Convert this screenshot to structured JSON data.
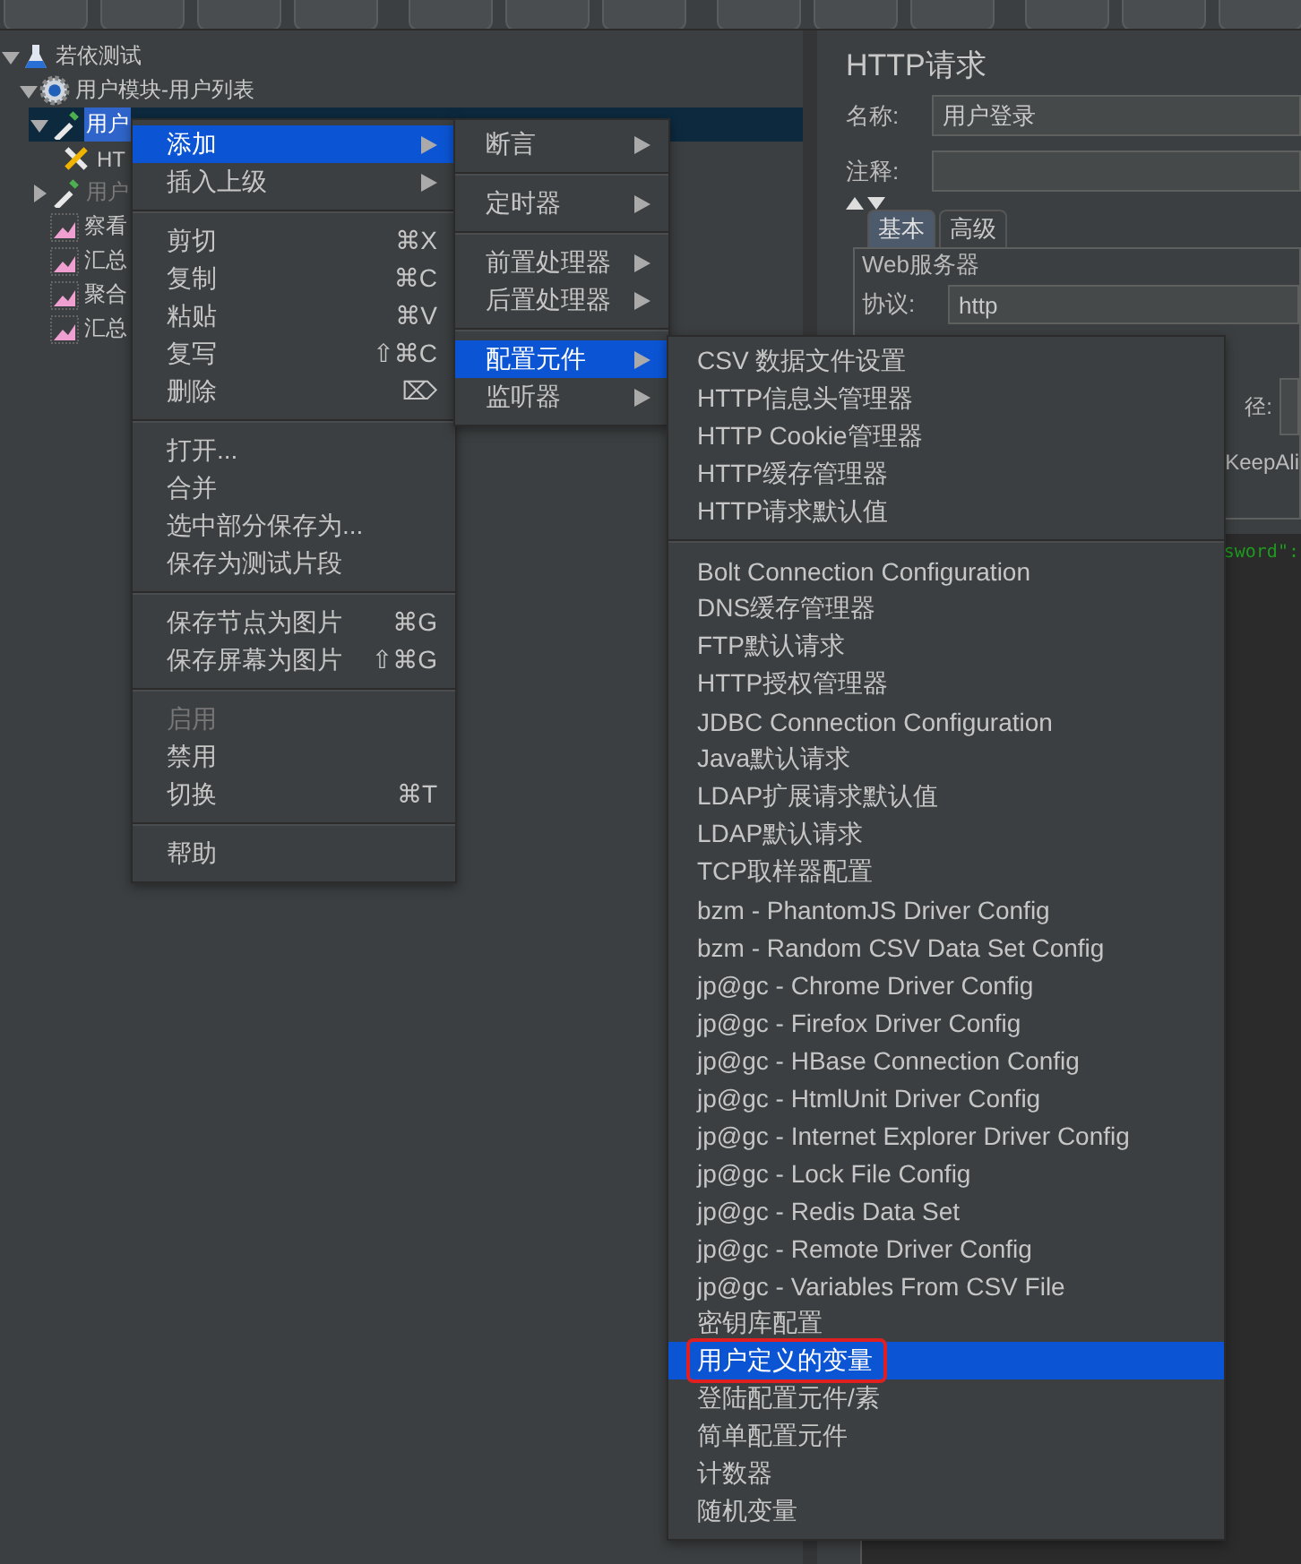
{
  "tree": [
    {
      "label": "若依测试",
      "kind": "plan",
      "expanded": true,
      "selected": false,
      "disabled": false,
      "children": [
        {
          "label": "用户模块-用户列表",
          "kind": "thread-group",
          "expanded": true,
          "selected": false,
          "disabled": false,
          "children": [
            {
              "label": "用户",
              "kind": "sampler",
              "expanded": true,
              "selected": true,
              "disabled": false,
              "children": [
                {
                  "label": "HT",
                  "kind": "config",
                  "selected": false,
                  "disabled": false
                }
              ]
            },
            {
              "label": "用户",
              "kind": "sampler",
              "expanded": false,
              "selected": false,
              "disabled": true
            },
            {
              "label": "察看",
              "kind": "listener",
              "selected": false,
              "disabled": false
            },
            {
              "label": "汇总",
              "kind": "listener",
              "selected": false,
              "disabled": false
            },
            {
              "label": "聚合",
              "kind": "listener",
              "selected": false,
              "disabled": false
            },
            {
              "label": "汇总",
              "kind": "listener",
              "selected": false,
              "disabled": false
            }
          ]
        }
      ]
    }
  ],
  "panel": {
    "title": "HTTP请求",
    "name_field": {
      "label": "名称:",
      "value": "用户登录"
    },
    "comment_field": {
      "label": "注释:"
    },
    "tabs": [
      {
        "label": "基本",
        "selected": true
      },
      {
        "label": "高级",
        "selected": false
      }
    ],
    "web_server": {
      "title": "Web服务器",
      "protocol": {
        "label": "协议:",
        "value": "http"
      }
    },
    "path_label": "径:",
    "keepalive_text": "KeepAli",
    "code_text": "sword\":"
  },
  "context_menu": [
    {
      "kind": "item",
      "label": "添加",
      "submenu": true,
      "selected": true,
      "disabled": false
    },
    {
      "kind": "item",
      "label": "插入上级",
      "submenu": true,
      "selected": false,
      "disabled": false
    },
    {
      "kind": "separator"
    },
    {
      "kind": "item",
      "label": "剪切",
      "shortcut": "⌘X",
      "selected": false,
      "disabled": false
    },
    {
      "kind": "item",
      "label": "复制",
      "shortcut": "⌘C",
      "selected": false,
      "disabled": false
    },
    {
      "kind": "item",
      "label": "粘贴",
      "shortcut": "⌘V",
      "selected": false,
      "disabled": false
    },
    {
      "kind": "item",
      "label": "复写",
      "shortcut": "⇧⌘C",
      "selected": false,
      "disabled": false
    },
    {
      "kind": "item",
      "label": "删除",
      "shortcut": "⌦",
      "selected": false,
      "disabled": false
    },
    {
      "kind": "separator"
    },
    {
      "kind": "item",
      "label": "打开...",
      "selected": false,
      "disabled": false
    },
    {
      "kind": "item",
      "label": "合并",
      "selected": false,
      "disabled": false
    },
    {
      "kind": "item",
      "label": "选中部分保存为...",
      "selected": false,
      "disabled": false
    },
    {
      "kind": "item",
      "label": "保存为测试片段",
      "selected": false,
      "disabled": false
    },
    {
      "kind": "separator"
    },
    {
      "kind": "item",
      "label": "保存节点为图片",
      "shortcut": "⌘G",
      "selected": false,
      "disabled": false
    },
    {
      "kind": "item",
      "label": "保存屏幕为图片",
      "shortcut": "⇧⌘G",
      "selected": false,
      "disabled": false
    },
    {
      "kind": "separator"
    },
    {
      "kind": "item",
      "label": "启用",
      "selected": false,
      "disabled": true
    },
    {
      "kind": "item",
      "label": "禁用",
      "selected": false,
      "disabled": false
    },
    {
      "kind": "item",
      "label": "切换",
      "shortcut": "⌘T",
      "selected": false,
      "disabled": false
    },
    {
      "kind": "separator"
    },
    {
      "kind": "item",
      "label": "帮助",
      "selected": false,
      "disabled": false
    }
  ],
  "add_submenu": [
    {
      "kind": "item",
      "label": "断言",
      "submenu": true,
      "selected": false
    },
    {
      "kind": "separator"
    },
    {
      "kind": "item",
      "label": "定时器",
      "submenu": true,
      "selected": false
    },
    {
      "kind": "separator"
    },
    {
      "kind": "item",
      "label": "前置处理器",
      "submenu": true,
      "selected": false
    },
    {
      "kind": "item",
      "label": "后置处理器",
      "submenu": true,
      "selected": false
    },
    {
      "kind": "separator"
    },
    {
      "kind": "item",
      "label": "配置元件",
      "submenu": true,
      "selected": true
    },
    {
      "kind": "item",
      "label": "监听器",
      "submenu": true,
      "selected": false
    }
  ],
  "config_submenu": [
    {
      "kind": "item",
      "label": "CSV 数据文件设置",
      "selected": false,
      "annotated": false
    },
    {
      "kind": "item",
      "label": "HTTP信息头管理器",
      "selected": false,
      "annotated": false
    },
    {
      "kind": "item",
      "label": "HTTP Cookie管理器",
      "selected": false,
      "annotated": false
    },
    {
      "kind": "item",
      "label": "HTTP缓存管理器",
      "selected": false,
      "annotated": false
    },
    {
      "kind": "item",
      "label": "HTTP请求默认值",
      "selected": false,
      "annotated": false
    },
    {
      "kind": "separator"
    },
    {
      "kind": "item",
      "label": "Bolt Connection Configuration",
      "selected": false,
      "annotated": false
    },
    {
      "kind": "item",
      "label": "DNS缓存管理器",
      "selected": false,
      "annotated": false
    },
    {
      "kind": "item",
      "label": "FTP默认请求",
      "selected": false,
      "annotated": false
    },
    {
      "kind": "item",
      "label": "HTTP授权管理器",
      "selected": false,
      "annotated": false
    },
    {
      "kind": "item",
      "label": "JDBC Connection Configuration",
      "selected": false,
      "annotated": false
    },
    {
      "kind": "item",
      "label": "Java默认请求",
      "selected": false,
      "annotated": false
    },
    {
      "kind": "item",
      "label": "LDAP扩展请求默认值",
      "selected": false,
      "annotated": false
    },
    {
      "kind": "item",
      "label": "LDAP默认请求",
      "selected": false,
      "annotated": false
    },
    {
      "kind": "item",
      "label": "TCP取样器配置",
      "selected": false,
      "annotated": false
    },
    {
      "kind": "item",
      "label": "bzm - PhantomJS Driver Config",
      "selected": false,
      "annotated": false
    },
    {
      "kind": "item",
      "label": "bzm - Random CSV Data Set Config",
      "selected": false,
      "annotated": false
    },
    {
      "kind": "item",
      "label": "jp@gc - Chrome Driver Config",
      "selected": false,
      "annotated": false
    },
    {
      "kind": "item",
      "label": "jp@gc - Firefox Driver Config",
      "selected": false,
      "annotated": false
    },
    {
      "kind": "item",
      "label": "jp@gc - HBase Connection Config",
      "selected": false,
      "annotated": false
    },
    {
      "kind": "item",
      "label": "jp@gc - HtmlUnit Driver Config",
      "selected": false,
      "annotated": false
    },
    {
      "kind": "item",
      "label": "jp@gc - Internet Explorer Driver Config",
      "selected": false,
      "annotated": false
    },
    {
      "kind": "item",
      "label": "jp@gc - Lock File Config",
      "selected": false,
      "annotated": false
    },
    {
      "kind": "item",
      "label": "jp@gc - Redis Data Set",
      "selected": false,
      "annotated": false
    },
    {
      "kind": "item",
      "label": "jp@gc - Remote Driver Config",
      "selected": false,
      "annotated": false
    },
    {
      "kind": "item",
      "label": "jp@gc - Variables From CSV File",
      "selected": false,
      "annotated": false
    },
    {
      "kind": "item",
      "label": "密钥库配置",
      "selected": false,
      "annotated": false
    },
    {
      "kind": "item",
      "label": "用户定义的变量",
      "selected": true,
      "annotated": true
    },
    {
      "kind": "item",
      "label": "登陆配置元件/素",
      "selected": false,
      "annotated": false
    },
    {
      "kind": "item",
      "label": "简单配置元件",
      "selected": false,
      "annotated": false
    },
    {
      "kind": "item",
      "label": "计数器",
      "selected": false,
      "annotated": false
    },
    {
      "kind": "item",
      "label": "随机变量",
      "selected": false,
      "annotated": false
    }
  ]
}
